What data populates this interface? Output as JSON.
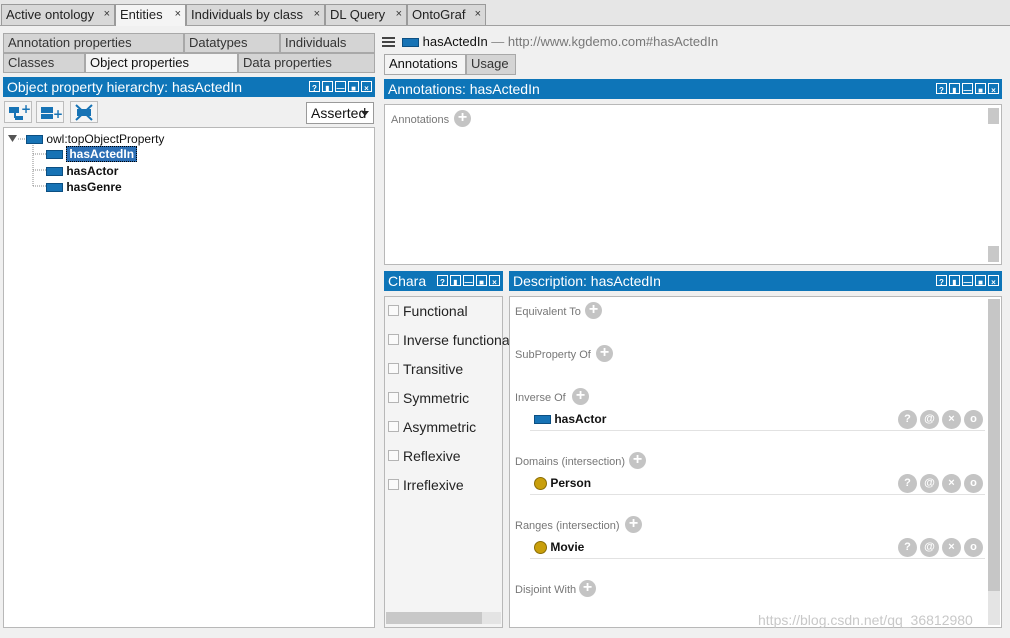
{
  "top_tabs": [
    {
      "label": "Active ontology",
      "close": "×"
    },
    {
      "label": "Entities",
      "close": "×"
    },
    {
      "label": "Individuals by class",
      "close": "×"
    },
    {
      "label": "DL Query",
      "close": "×"
    },
    {
      "label": "OntoGraf",
      "close": "×"
    }
  ],
  "sub_tabs": {
    "row1": [
      "Annotation properties",
      "Datatypes",
      "Individuals"
    ],
    "row2": [
      "Classes",
      "Object properties",
      "Data properties"
    ]
  },
  "hierarchy": {
    "title": "Object property hierarchy: hasActedIn",
    "mode": "Asserted",
    "root": "owl:topObjectProperty",
    "children": [
      "hasActedIn",
      "hasActor",
      "hasGenre"
    ]
  },
  "header": {
    "entity": "hasActedIn",
    "separator": "—",
    "iri": "http://www.kgdemo.com#hasActedIn"
  },
  "right_tabs": [
    "Annotations",
    "Usage"
  ],
  "annotations_panel": {
    "title": "Annotations: hasActedIn",
    "label": "Annotations"
  },
  "characteristics": {
    "title": "Chara",
    "items": [
      "Functional",
      "Inverse functional",
      "Transitive",
      "Symmetric",
      "Asymmetric",
      "Reflexive",
      "Irreflexive"
    ]
  },
  "description": {
    "title": "Description: hasActedIn",
    "sections": [
      {
        "label": "Equivalent To"
      },
      {
        "label": "SubProperty Of"
      },
      {
        "label": "Inverse Of",
        "item": "hasActor"
      },
      {
        "label": "Domains (intersection)",
        "item": "Person"
      },
      {
        "label": "Ranges (intersection)",
        "item": "Movie"
      },
      {
        "label": "Disjoint With"
      }
    ]
  },
  "panel_buttons": [
    "?",
    "▮",
    "—",
    "■",
    "×"
  ],
  "row_controls": [
    "?",
    "@",
    "×",
    "o"
  ],
  "watermark": "https://blog.csdn.net/qq_36812980",
  "colors": {
    "header_blue": "#0e75b8",
    "property_blue": "#1773b5",
    "individual_gold": "#c99f0b"
  }
}
